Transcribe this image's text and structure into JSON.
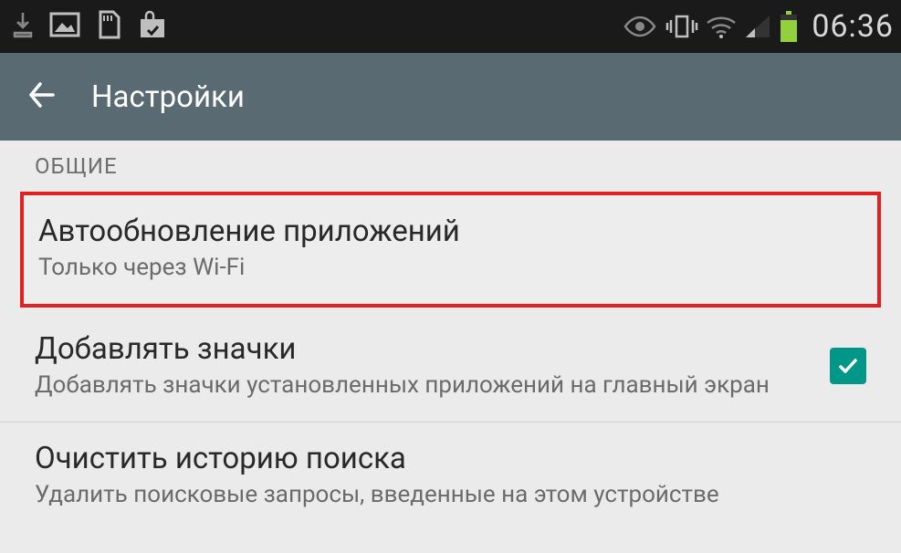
{
  "status": {
    "time": "06:36"
  },
  "appbar": {
    "title": "Настройки"
  },
  "section": {
    "header": "ОБЩИЕ"
  },
  "items": {
    "autoupdate": {
      "title": "Автообновление приложений",
      "subtitle": "Только через Wi-Fi"
    },
    "addicons": {
      "title": "Добавлять значки",
      "subtitle": "Добавлять значки установленных приложений на главный экран",
      "checked": true
    },
    "clearhistory": {
      "title": "Очистить историю поиска",
      "subtitle": "Удалить поисковые запросы, введенные на этом устройстве"
    }
  }
}
